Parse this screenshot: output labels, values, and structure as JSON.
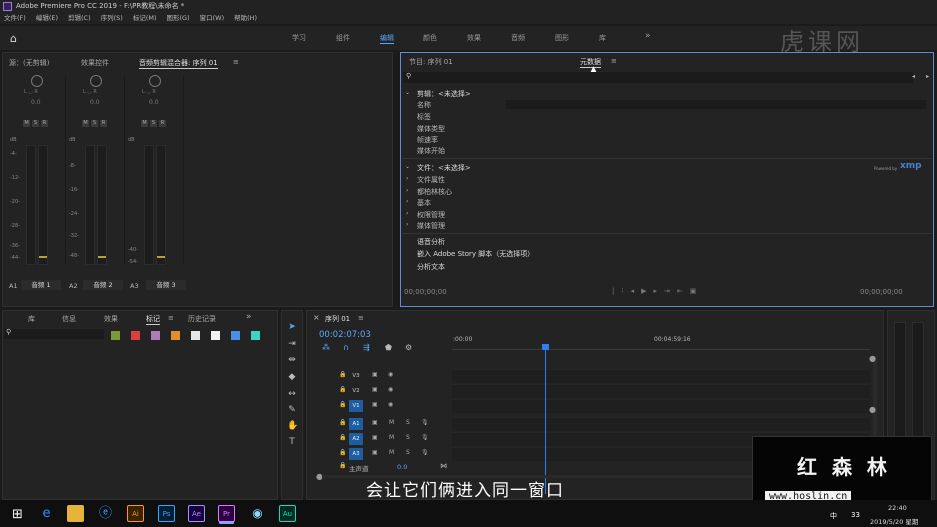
{
  "window": {
    "title": "Adobe Premiere Pro CC 2019 - F:\\PR教程\\未命名 *"
  },
  "menu": [
    "文件(F)",
    "编辑(E)",
    "剪辑(C)",
    "序列(S)",
    "标记(M)",
    "图形(G)",
    "窗口(W)",
    "帮助(H)"
  ],
  "workspaces": [
    "学习",
    "组件",
    "编辑",
    "颜色",
    "效果",
    "音频",
    "图形",
    "库"
  ],
  "workspace_more": "»",
  "watermark_logo": "虎课网",
  "left_panel": {
    "tabs": [
      "源：(无剪辑)",
      "效果控件",
      "音频剪辑混合器: 序列 01"
    ],
    "menu_icon": "≡",
    "channels": [
      {
        "id": "A1",
        "name": "音频 1",
        "value": "0.0"
      },
      {
        "id": "A2",
        "name": "音频 2",
        "value": "0.0"
      },
      {
        "id": "A3",
        "name": "音频 3",
        "value": "0.0"
      }
    ],
    "lr": "L ◡ R",
    "msr": [
      "M",
      "S",
      "R"
    ],
    "db_scale": [
      "dB",
      "-4-",
      "-8-",
      "-12-",
      "-16-",
      "-20-",
      "-24-",
      "-28-",
      "-32-",
      "-36-",
      "-40-",
      "-44-",
      "-48-",
      "-54-"
    ]
  },
  "right_panel": {
    "tabs": [
      "节目: 序列 01",
      "元数据"
    ],
    "menu_icon": "≡",
    "search_icon": "search-icon",
    "sections": {
      "clip": {
        "header": "剪辑：<未选择>",
        "rows": [
          "名称",
          "标签",
          "媒体类型",
          "帧速率",
          "媒体开始"
        ]
      },
      "file": {
        "header": "文件：<未选择>",
        "rows": [
          "文件属性",
          "都柏林核心",
          "基本",
          "权限管理",
          "媒体管理"
        ]
      },
      "speech": {
        "header": "语音分析",
        "embedded": "嵌入 Adobe Story 脚本（无选择项）",
        "text_row": "分析文本"
      }
    },
    "xmp_small": "Powered by",
    "xmp": "xmp",
    "tc_left": "00;00;00;00",
    "tc_right": "00;00;00;00"
  },
  "bottom_left": {
    "tabs": [
      "库",
      "信息",
      "效果",
      "标记",
      "历史记录"
    ],
    "more": "»",
    "search_icon": "search-icon",
    "swatches": [
      "#7a9a3a",
      "#d94040",
      "#b07ab8",
      "#e0902a",
      "#e6e6e6",
      "#f2f2f2",
      "#4a90e2",
      "#3ad6c2"
    ]
  },
  "timeline": {
    "tab": "序列 01",
    "menu_icon": "≡",
    "close": "×",
    "timecode": "00:02:07:03",
    "ruler": [
      ":00:00",
      "00:04:59:16"
    ],
    "video_tracks": [
      "V3",
      "V2",
      "V1"
    ],
    "audio_tracks": [
      "A1",
      "A2",
      "A3"
    ],
    "master": {
      "label": "主声道",
      "value": "0.0"
    },
    "m": "M",
    "s": "S",
    "playhead_fraction": 0.222
  },
  "subtitle": "会让它们俩进入同一窗口",
  "brand_overlay": {
    "cn": "红 森 林",
    "url": "www.hoslin.cn"
  },
  "taskbar": {
    "apps": [
      "Ai",
      "Ps",
      "Ae",
      "Pr",
      "Au"
    ],
    "time": "22:40",
    "date": "2019/5/20 星期",
    "tray": [
      "中",
      "33"
    ]
  },
  "colors": {
    "accent": "#5aa6ff",
    "track_on": "#1d5da0",
    "playhead": "#2d7ff0"
  }
}
